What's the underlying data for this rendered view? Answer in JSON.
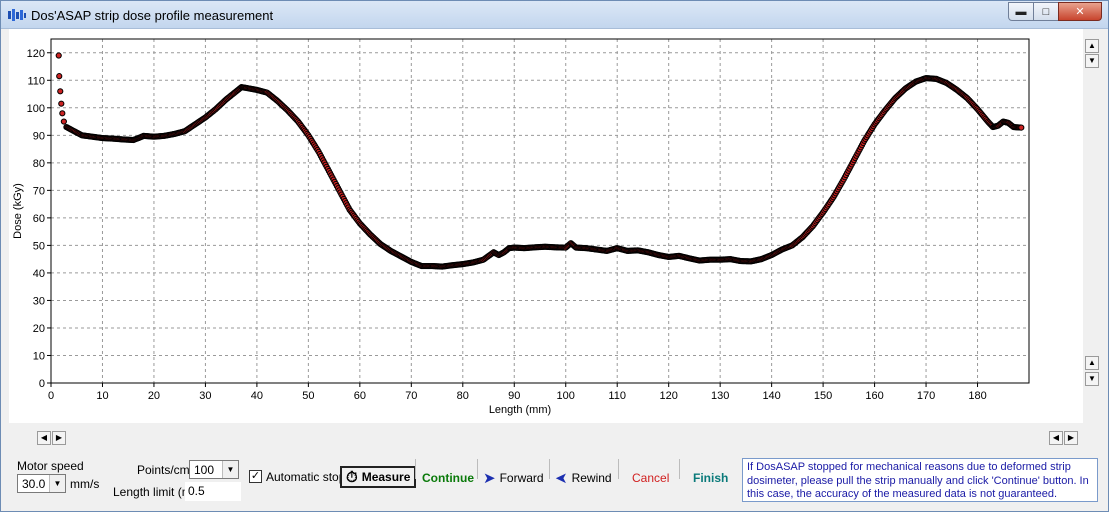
{
  "window": {
    "title": "Dos'ASAP strip dose profile measurement"
  },
  "icons": {
    "app": "app-icon",
    "minimize": "minimize-icon",
    "maximize": "maximize-icon",
    "close": "close-icon"
  },
  "chart_data": {
    "type": "scatter",
    "xlabel": "Length (mm)",
    "ylabel": "Dose (kGy)",
    "xlim": [
      0,
      190
    ],
    "ylim": [
      0,
      125
    ],
    "xticks": [
      0,
      10,
      20,
      30,
      40,
      50,
      60,
      70,
      80,
      90,
      100,
      110,
      120,
      130,
      140,
      150,
      160,
      170,
      180
    ],
    "yticks": [
      0,
      10,
      20,
      30,
      40,
      50,
      60,
      70,
      80,
      90,
      100,
      110,
      120
    ],
    "grid": true,
    "marker_color": "#cc2222",
    "marker_edge": "#000000",
    "points": [
      [
        1.5,
        119
      ],
      [
        1.6,
        111.5
      ],
      [
        1.8,
        106
      ],
      [
        2.0,
        101.5
      ],
      [
        2.2,
        98
      ],
      [
        2.5,
        95
      ],
      [
        3,
        93
      ],
      [
        4,
        92
      ],
      [
        6,
        90
      ],
      [
        8,
        89.5
      ],
      [
        10,
        89
      ],
      [
        12,
        88.8
      ],
      [
        14,
        88.5
      ],
      [
        16,
        88.3
      ],
      [
        17,
        89
      ],
      [
        18,
        89.8
      ],
      [
        20,
        89.5
      ],
      [
        22,
        89.8
      ],
      [
        24,
        90.5
      ],
      [
        26,
        91.5
      ],
      [
        28,
        94
      ],
      [
        30,
        96.5
      ],
      [
        32,
        99.5
      ],
      [
        34,
        103
      ],
      [
        36,
        106
      ],
      [
        37,
        107.5
      ],
      [
        38,
        107.2
      ],
      [
        40,
        106.5
      ],
      [
        42,
        105.5
      ],
      [
        44,
        102.5
      ],
      [
        46,
        99
      ],
      [
        48,
        95
      ],
      [
        50,
        90
      ],
      [
        52,
        84
      ],
      [
        54,
        77
      ],
      [
        56,
        70
      ],
      [
        58,
        63
      ],
      [
        60,
        58
      ],
      [
        62,
        54
      ],
      [
        64,
        50.5
      ],
      [
        66,
        48
      ],
      [
        68,
        46
      ],
      [
        70,
        44
      ],
      [
        72,
        42.5
      ],
      [
        74,
        42.5
      ],
      [
        76,
        42.3
      ],
      [
        78,
        42.8
      ],
      [
        80,
        43.2
      ],
      [
        82,
        43.8
      ],
      [
        84,
        44.8
      ],
      [
        86,
        47.5
      ],
      [
        87,
        46.5
      ],
      [
        88,
        47.5
      ],
      [
        89,
        49
      ],
      [
        90,
        49.2
      ],
      [
        92,
        49
      ],
      [
        94,
        49.3
      ],
      [
        96,
        49.5
      ],
      [
        98,
        49.3
      ],
      [
        100,
        49.2
      ],
      [
        101,
        50.8
      ],
      [
        102,
        49.2
      ],
      [
        104,
        49
      ],
      [
        106,
        48.5
      ],
      [
        108,
        48
      ],
      [
        110,
        49
      ],
      [
        112,
        48
      ],
      [
        114,
        48.2
      ],
      [
        116,
        47.5
      ],
      [
        118,
        46.5
      ],
      [
        120,
        45.8
      ],
      [
        122,
        46.2
      ],
      [
        124,
        45.3
      ],
      [
        126,
        44.5
      ],
      [
        128,
        44.8
      ],
      [
        130,
        44.8
      ],
      [
        132,
        45
      ],
      [
        134,
        44.3
      ],
      [
        136,
        44.2
      ],
      [
        138,
        45
      ],
      [
        140,
        46.5
      ],
      [
        142,
        48.5
      ],
      [
        144,
        50
      ],
      [
        146,
        53
      ],
      [
        148,
        57
      ],
      [
        150,
        62
      ],
      [
        152,
        67.5
      ],
      [
        154,
        74
      ],
      [
        156,
        81
      ],
      [
        158,
        88
      ],
      [
        160,
        94
      ],
      [
        162,
        99
      ],
      [
        164,
        103.5
      ],
      [
        166,
        107
      ],
      [
        168,
        109.5
      ],
      [
        170,
        110.8
      ],
      [
        172,
        110.5
      ],
      [
        174,
        109
      ],
      [
        176,
        106.5
      ],
      [
        178,
        103.5
      ],
      [
        180,
        99.5
      ],
      [
        182,
        95
      ],
      [
        183,
        93
      ],
      [
        184,
        93.5
      ],
      [
        185,
        95
      ],
      [
        186,
        94.5
      ],
      [
        187,
        93
      ],
      [
        188.5,
        92.8
      ]
    ]
  },
  "controls": {
    "motor_speed_label": "Motor speed",
    "motor_speed_value": "30.0",
    "motor_speed_unit": "mm/s",
    "points_per_cm_label": "Points/cm",
    "points_per_cm_value": "100",
    "length_limit_label": "Length limit (m)",
    "length_limit_value": "0.5",
    "automatic_stop_label": "Automatic stop",
    "automatic_stop_checked": true,
    "measure_label": "Measure",
    "continue_label": "Continue",
    "forward_label": "Forward",
    "rewind_label": "Rewind",
    "cancel_label": "Cancel",
    "finish_label": "Finish",
    "colors": {
      "continue": "#0a7a0a",
      "cancel": "#d11f1f",
      "finish": "#0a7a7a",
      "forward": "#1c2fb0",
      "rewind": "#1c2fb0",
      "info_text": "#1a1aa6"
    },
    "info_message": "If DosASAP stopped for mechanical reasons due to deformed strip dosimeter, please pull the strip manually and click 'Continue' button. In this case, the accuracy of the measured data is not guaranteed."
  }
}
